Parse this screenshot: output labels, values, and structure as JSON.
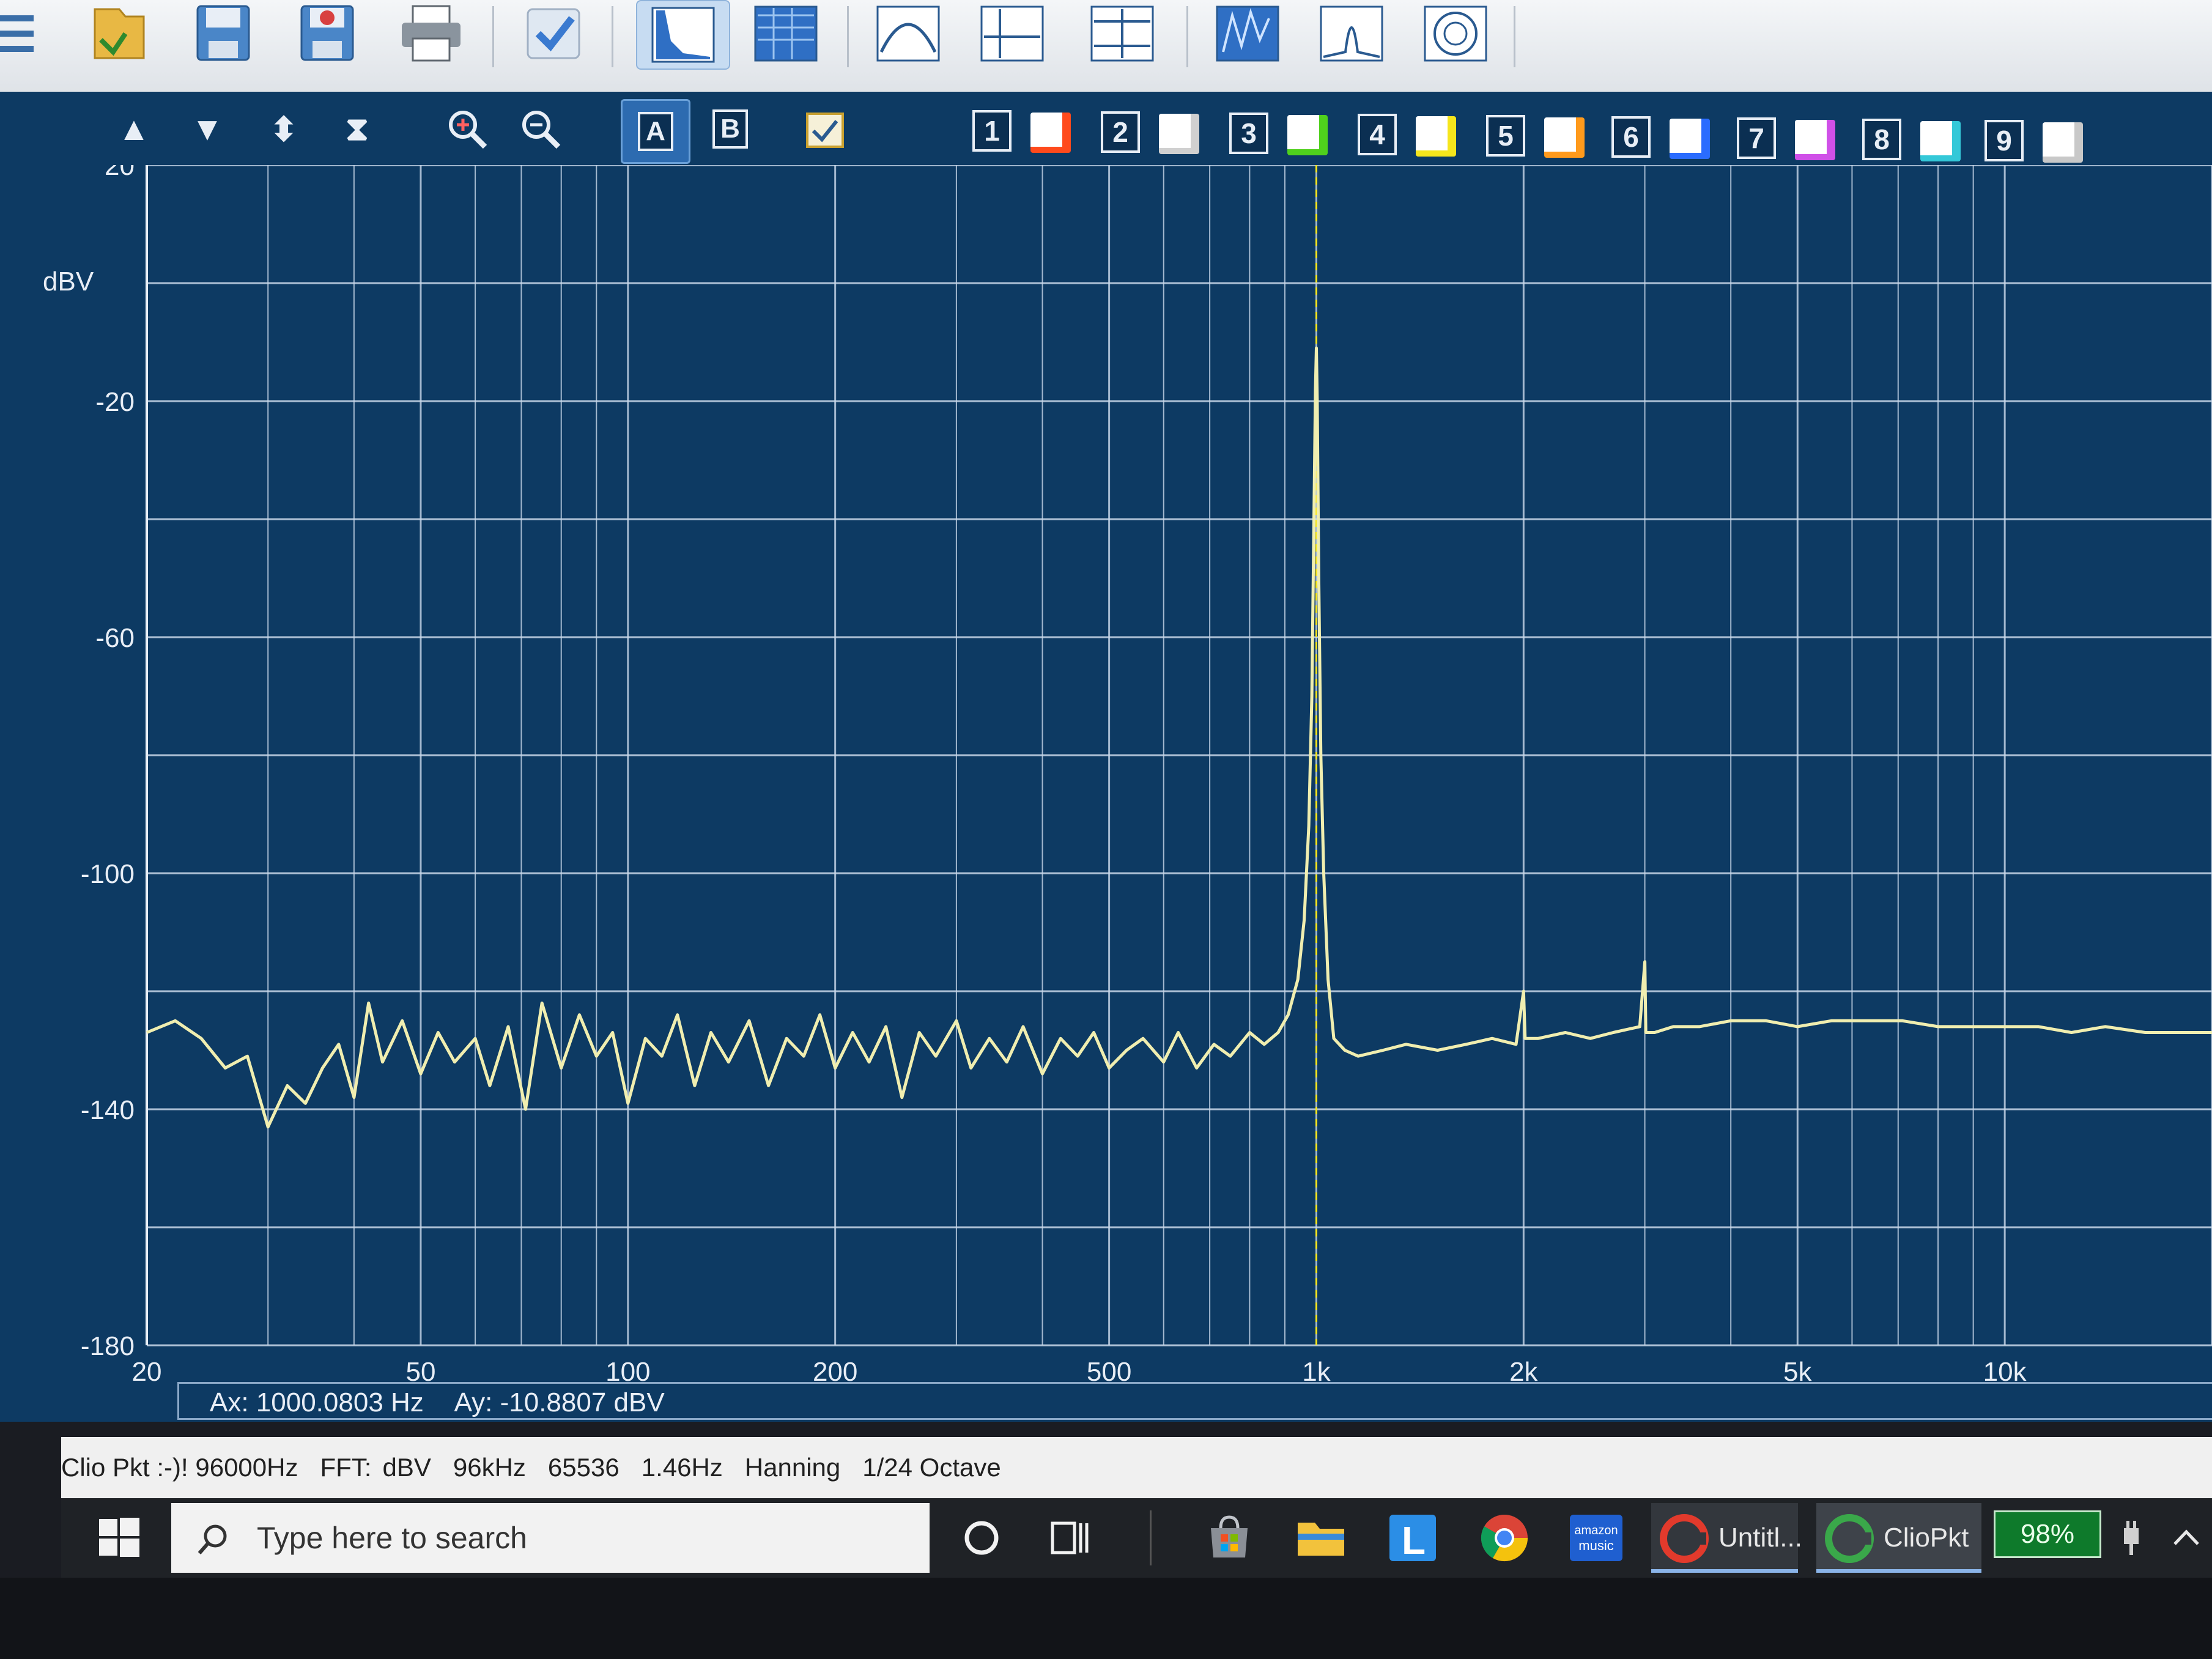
{
  "statusbar": {
    "app": "Clio Pkt :-)! 96000Hz",
    "fft": "FFT:",
    "unit": "dBV",
    "rate": "96kHz",
    "size": "65536",
    "resolution": "1.46Hz",
    "window": "Hanning",
    "smoothing": "1/24 Octave"
  },
  "controls": {
    "buttons": [
      "A",
      "B"
    ],
    "traces": [
      "1",
      "2",
      "3",
      "4",
      "5",
      "6",
      "7",
      "8",
      "9"
    ],
    "trace_colors": [
      "#ff4a1c",
      "#f2f2f2",
      "#4fd01c",
      "#f6e61c",
      "#ff9a1c",
      "#2a6cff",
      "#d050e8",
      "#34c8d8",
      "#f2f2f2"
    ]
  },
  "readout": {
    "ax": "Ax: 1000.0803 Hz",
    "ay": "Ay: -10.8807 dBV"
  },
  "taskbar": {
    "search_placeholder": "Type here to search",
    "apps": [
      "Untitl...",
      "ClioPkt"
    ],
    "amazon_label_1": "amazon",
    "amazon_label_2": "music",
    "launcher_letter": "L",
    "battery": "98%"
  },
  "chart_data": {
    "type": "line",
    "ylabel": "dBV",
    "xscale": "log",
    "xlim": [
      20,
      20000
    ],
    "ylim": [
      -180,
      20
    ],
    "grid": true,
    "y_ticks": [
      "20",
      "-20",
      "-60",
      "-100",
      "-140",
      "-180"
    ],
    "y_tick_values": [
      20,
      -20,
      -60,
      -100,
      -140,
      -180
    ],
    "x_ticks": [
      "20",
      "50",
      "100",
      "200",
      "500",
      "1k",
      "2k",
      "5k",
      "10k"
    ],
    "x_tick_values": [
      20,
      50,
      100,
      200,
      500,
      1000,
      2000,
      5000,
      10000
    ],
    "cursor_x": 1000,
    "series": [
      {
        "color": "#f0eeb0",
        "x": [
          20,
          22,
          24,
          26,
          28,
          30,
          32,
          34,
          36,
          38,
          40,
          42,
          44,
          47,
          50,
          53,
          56,
          60,
          63,
          67,
          71,
          75,
          80,
          85,
          90,
          95,
          100,
          106,
          112,
          118,
          125,
          132,
          140,
          150,
          160,
          170,
          180,
          190,
          200,
          212,
          224,
          237,
          250,
          265,
          280,
          300,
          315,
          335,
          355,
          375,
          400,
          425,
          450,
          475,
          500,
          530,
          560,
          600,
          630,
          670,
          710,
          750,
          800,
          840,
          880,
          910,
          940,
          960,
          975,
          985,
          992,
          997,
          1000,
          1003,
          1008,
          1015,
          1025,
          1040,
          1060,
          1100,
          1150,
          1250,
          1350,
          1500,
          1650,
          1800,
          1950,
          2000,
          2010,
          2100,
          2300,
          2500,
          2700,
          2950,
          3000,
          3010,
          3100,
          3300,
          3600,
          4000,
          4500,
          5000,
          5600,
          6300,
          7100,
          8000,
          9000,
          10000,
          11200,
          12500,
          14000,
          16000,
          18000,
          20000
        ],
        "y": [
          -127,
          -125,
          -128,
          -133,
          -131,
          -143,
          -136,
          -139,
          -133,
          -129,
          -138,
          -122,
          -132,
          -125,
          -134,
          -127,
          -132,
          -128,
          -136,
          -126,
          -140,
          -122,
          -133,
          -124,
          -131,
          -127,
          -139,
          -128,
          -131,
          -124,
          -136,
          -127,
          -132,
          -125,
          -136,
          -128,
          -131,
          -124,
          -133,
          -127,
          -132,
          -126,
          -138,
          -127,
          -131,
          -125,
          -133,
          -128,
          -132,
          -126,
          -134,
          -128,
          -131,
          -127,
          -133,
          -130,
          -128,
          -132,
          -127,
          -133,
          -129,
          -131,
          -127,
          -129,
          -127,
          -124,
          -118,
          -108,
          -92,
          -70,
          -40,
          -18,
          -11,
          -20,
          -50,
          -80,
          -100,
          -118,
          -128,
          -130,
          -131,
          -130,
          -129,
          -130,
          -129,
          -128,
          -129,
          -120,
          -128,
          -128,
          -127,
          -128,
          -127,
          -126,
          -115,
          -127,
          -127,
          -126,
          -126,
          -125,
          -125,
          -126,
          -125,
          -125,
          -125,
          -126,
          -126,
          -126,
          -126,
          -127,
          -126,
          -127,
          -127,
          -127
        ]
      }
    ]
  }
}
